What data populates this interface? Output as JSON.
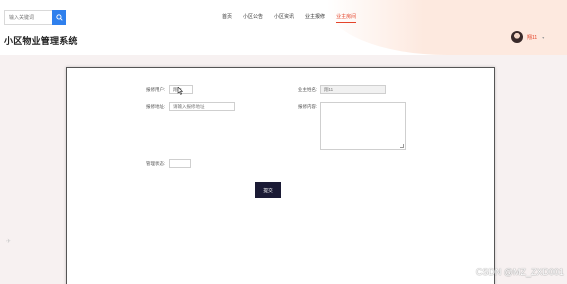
{
  "header": {
    "search": {
      "placeholder": "输入关键词",
      "value": ""
    },
    "search_icon": "search-icon",
    "site_title": "小区物业管理系统",
    "nav": [
      {
        "label": "首页",
        "active": false
      },
      {
        "label": "小区公告",
        "active": false
      },
      {
        "label": "小区资讯",
        "active": false
      },
      {
        "label": "业主报修",
        "active": false
      },
      {
        "label": "业主房间",
        "active": true
      }
    ],
    "user": {
      "name": "翔11",
      "caret": "▾"
    }
  },
  "form": {
    "fields": {
      "report_user": {
        "label": "报修用户:",
        "value": "翔11"
      },
      "owner_name": {
        "label": "业主姓名:",
        "placeholder": "翔11"
      },
      "repair_address": {
        "label": "报修地址:",
        "placeholder": "请输入报修地址"
      },
      "repair_content": {
        "label": "报修内容:",
        "value": ""
      },
      "process_status": {
        "label": "管理状态:",
        "value": ""
      }
    },
    "submit_label": "提交"
  },
  "watermark": "CSDN @MZ_ZXD001",
  "colors": {
    "accent": "#2f80ed",
    "active_nav": "#e4442a",
    "submit_bg": "#1b1b35",
    "page_bg": "#f7f1f1"
  }
}
